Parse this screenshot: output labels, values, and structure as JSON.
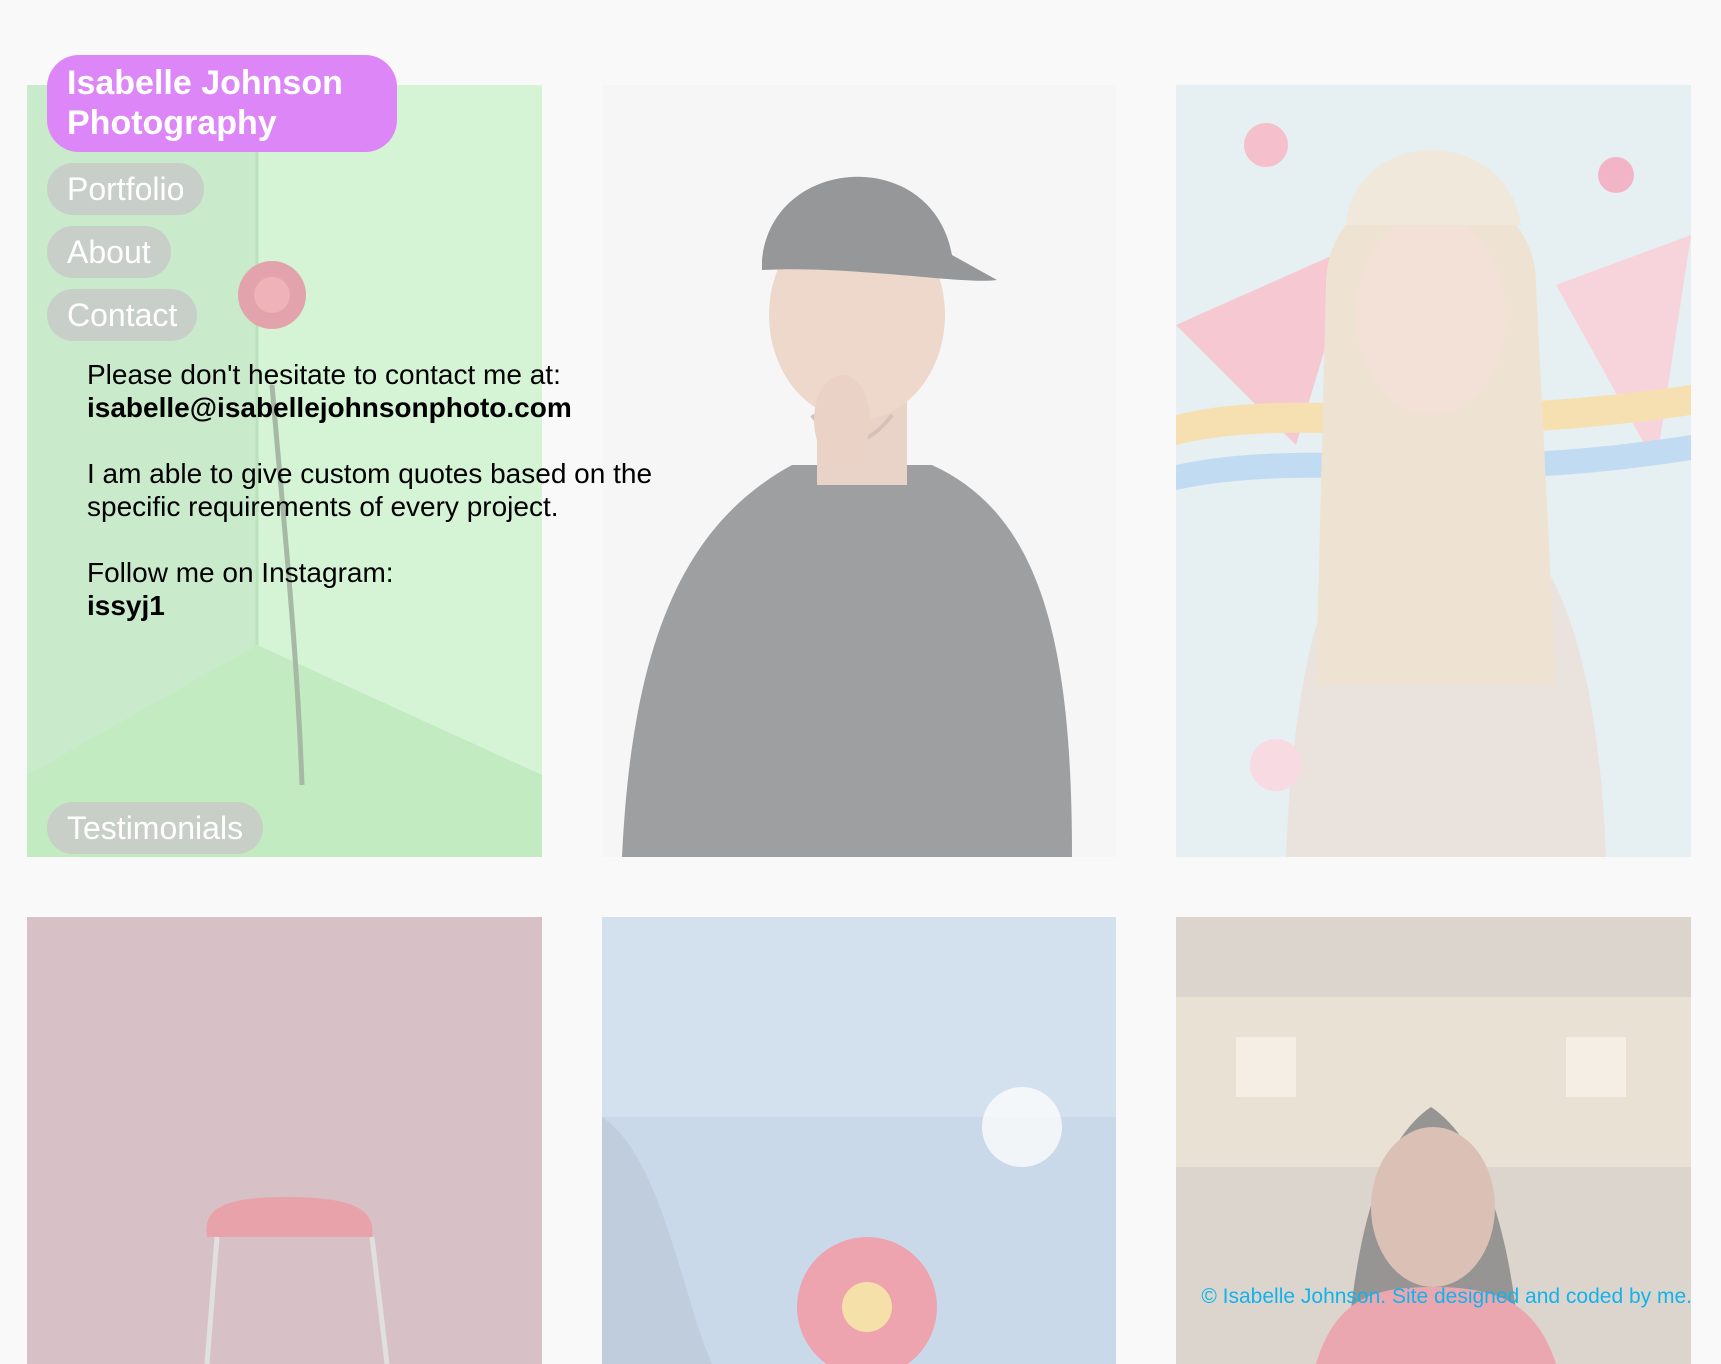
{
  "site": {
    "brand": "Isabelle Johnson Photography",
    "brand_color": "#dd86f7",
    "nav": {
      "portfolio": "Portfolio",
      "about": "About",
      "contact": "Contact",
      "testimonials": "Testimonials"
    }
  },
  "contact": {
    "intro": "Please don't hesitate to contact me at:",
    "email": "isabelle@isabellejohnsonphoto.com",
    "quotes": "I am able to give custom quotes based on the specific requirements of every project.",
    "instagram_label": "Follow me on Instagram:",
    "instagram_handle": "issyj1"
  },
  "gallery": [
    {
      "subject": "red flower on green background"
    },
    {
      "subject": "man in cap and patterned shirt"
    },
    {
      "subject": "woman in cap with illustrated background"
    },
    {
      "subject": "red chair against maroon wall"
    },
    {
      "subject": "red flower against blue sky"
    },
    {
      "subject": "smiling woman outdoors"
    }
  ],
  "footer": {
    "text": "© Isabelle Johnson. Site designed and coded by me.",
    "color": "#12b3ec"
  }
}
